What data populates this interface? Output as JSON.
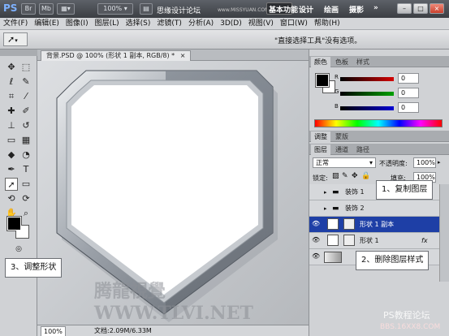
{
  "topbar": {
    "ps_logo": "PS",
    "br_label": "Br",
    "mb_label": "Mb",
    "zoom": "100%",
    "watermark_top": "思缘设计论坛",
    "watermark_url": "www.MISSYUAN.COM",
    "workspaces": [
      "基本功能",
      "设计",
      "绘画",
      "摄影"
    ],
    "more": "»",
    "window_buttons": [
      "–",
      "□",
      "×"
    ]
  },
  "menu": [
    "文件(F)",
    "编辑(E)",
    "图像(I)",
    "图层(L)",
    "选择(S)",
    "滤镜(T)",
    "分析(A)",
    "3D(D)",
    "视图(V)",
    "窗口(W)",
    "帮助(H)"
  ],
  "options_bar": {
    "tool_icon": "arrow-icon",
    "message": "\"直接选择工具\"没有选项。"
  },
  "document": {
    "tab_title": "背景.PSD @ 100% (形状 1 副本, RGB/8) *",
    "tab_close": "×",
    "zoom": "100%",
    "doc_info": "文档:2.09M/6.33M",
    "watermark": "腾龍視覺WWW.TLVI.NET"
  },
  "color_panel": {
    "tabs": [
      "颜色",
      "色板",
      "样式"
    ],
    "channels": [
      {
        "label": "R",
        "value": "0",
        "color": "#d40000"
      },
      {
        "label": "G",
        "value": "0",
        "color": "#00a000"
      },
      {
        "label": "B",
        "value": "0",
        "color": "#0000d4"
      }
    ]
  },
  "adjust_tabs": [
    "调整",
    "蒙版"
  ],
  "layers_panel": {
    "tabs": [
      "图层",
      "通道",
      "路径"
    ],
    "blend_mode": "正常",
    "opacity_label": "不透明度:",
    "opacity_value": "100%",
    "lock_label": "锁定:",
    "fill_label": "填充:",
    "fill_value": "100%",
    "layers": [
      {
        "name": "装饰 1",
        "type": "group",
        "visible": false,
        "selected": false
      },
      {
        "name": "装饰 2",
        "type": "group",
        "visible": false,
        "selected": false
      },
      {
        "name": "形状 1 副本",
        "type": "shape",
        "visible": true,
        "selected": true
      },
      {
        "name": "形状 1",
        "type": "shape",
        "visible": true,
        "selected": false,
        "fx": "fx"
      },
      {
        "name": "",
        "type": "background",
        "visible": true,
        "selected": false
      }
    ]
  },
  "callouts": {
    "copy_layer": "1、复制图层",
    "delete_style": "2、删除图层样式",
    "adjust_shape": "3、调整形状"
  },
  "footer_watermark": "PS教程论坛",
  "footer_watermark_url": "BBS.16XX8.COM"
}
